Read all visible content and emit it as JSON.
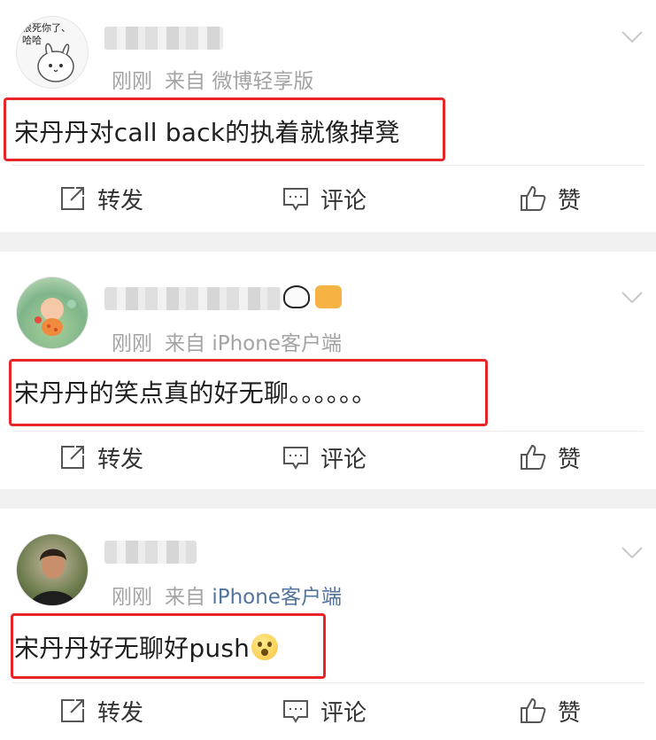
{
  "posts": [
    {
      "time": "刚刚",
      "source_prefix": "来自",
      "source": "微博轻享版",
      "source_is_link": false,
      "content": "宋丹丹对call back的执着就像掉凳",
      "avatar_text": "恨死你了、哈哈",
      "actions": {
        "repost": "转发",
        "comment": "评论",
        "like": "赞"
      }
    },
    {
      "time": "刚刚",
      "source_prefix": "来自",
      "source": "iPhone客户端",
      "source_is_link": false,
      "content": "宋丹丹的笑点真的好无聊。。。。。。",
      "actions": {
        "repost": "转发",
        "comment": "评论",
        "like": "赞"
      }
    },
    {
      "time": "刚刚",
      "source_prefix": "来自",
      "source": "iPhone客户端",
      "source_is_link": true,
      "content": "宋丹丹好无聊好push",
      "emoji": "flushed-face",
      "actions": {
        "repost": "转发",
        "comment": "评论",
        "like": "赞"
      }
    }
  ],
  "colors": {
    "highlight_border": "#e8262a",
    "meta_text": "#a3a3a3",
    "source_link": "#52749c",
    "separator_band": "#f0f0f0"
  },
  "icons": [
    "repost-icon",
    "comment-icon",
    "like-icon",
    "chevron-down-icon"
  ]
}
